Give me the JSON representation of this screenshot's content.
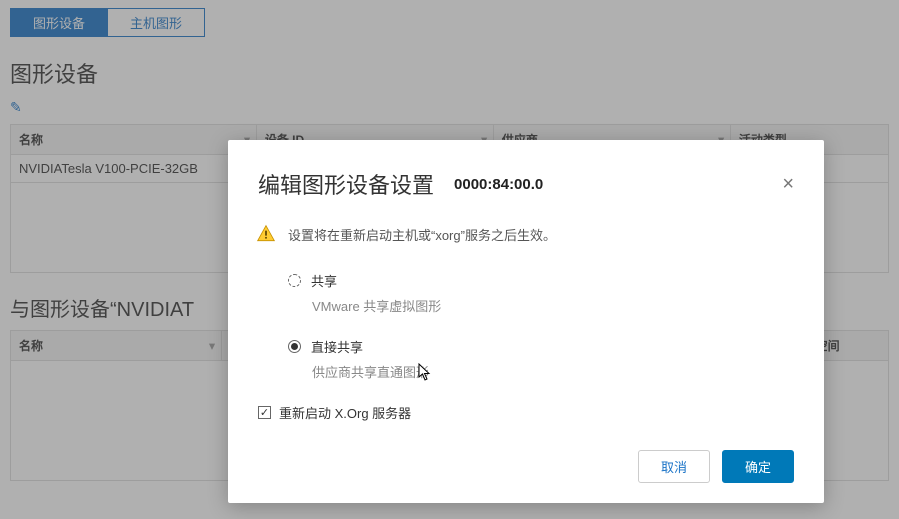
{
  "tabs": {
    "graphics_devices": "图形设备",
    "host_graphics": "主机图形"
  },
  "page_title": "图形设备",
  "table1": {
    "headers": {
      "name": "名称",
      "device_id": "设备 ID",
      "vendor": "供应商",
      "activity_type": "活动类型"
    },
    "row0": {
      "name": "NVIDIATesla V100-PCIE-32GB"
    }
  },
  "sub_title_prefix": "与图形设备“NVIDIAT",
  "table2": {
    "headers": {
      "name": "名称",
      "used_space": "已用空间"
    }
  },
  "modal": {
    "title": "编辑图形设备设置",
    "device_id": "0000:84:00.0",
    "warning": "设置将在重新启动主机或“xorg”服务之后生效。",
    "option_shared": {
      "label": "共享",
      "sub": "VMware 共享虚拟图形"
    },
    "option_direct": {
      "label": "直接共享",
      "sub": "供应商共享直通图形"
    },
    "restart_xorg": "重新启动 X.Org 服务器",
    "cancel": "取消",
    "ok": "确定"
  }
}
